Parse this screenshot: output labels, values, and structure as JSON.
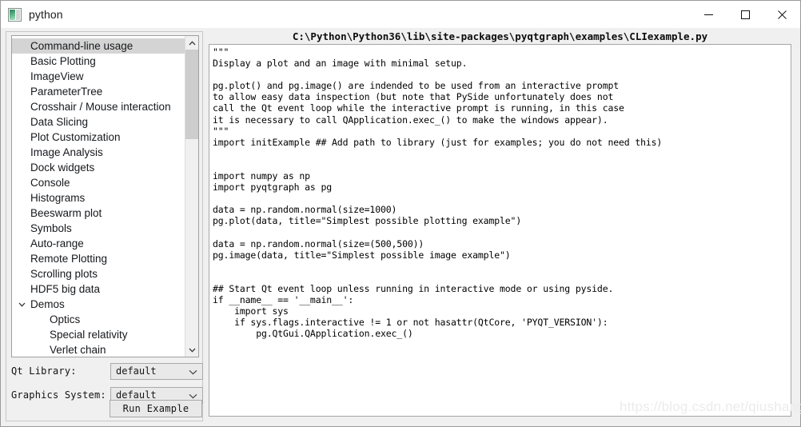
{
  "window": {
    "title": "python",
    "icon": "python-app-icon",
    "buttons": {
      "minimize": "minimize-icon",
      "maximize": "maximize-icon",
      "close": "close-icon"
    }
  },
  "examples_list": {
    "selected": "Command-line usage",
    "items": [
      {
        "label": "Command-line usage",
        "level": 0,
        "selected": true,
        "expandable": false
      },
      {
        "label": "Basic Plotting",
        "level": 0,
        "selected": false,
        "expandable": false
      },
      {
        "label": "ImageView",
        "level": 0,
        "selected": false,
        "expandable": false
      },
      {
        "label": "ParameterTree",
        "level": 0,
        "selected": false,
        "expandable": false
      },
      {
        "label": "Crosshair / Mouse interaction",
        "level": 0,
        "selected": false,
        "expandable": false
      },
      {
        "label": "Data Slicing",
        "level": 0,
        "selected": false,
        "expandable": false
      },
      {
        "label": "Plot Customization",
        "level": 0,
        "selected": false,
        "expandable": false
      },
      {
        "label": "Image Analysis",
        "level": 0,
        "selected": false,
        "expandable": false
      },
      {
        "label": "Dock widgets",
        "level": 0,
        "selected": false,
        "expandable": false
      },
      {
        "label": "Console",
        "level": 0,
        "selected": false,
        "expandable": false
      },
      {
        "label": "Histograms",
        "level": 0,
        "selected": false,
        "expandable": false
      },
      {
        "label": "Beeswarm plot",
        "level": 0,
        "selected": false,
        "expandable": false
      },
      {
        "label": "Symbols",
        "level": 0,
        "selected": false,
        "expandable": false
      },
      {
        "label": "Auto-range",
        "level": 0,
        "selected": false,
        "expandable": false
      },
      {
        "label": "Remote Plotting",
        "level": 0,
        "selected": false,
        "expandable": false
      },
      {
        "label": "Scrolling plots",
        "level": 0,
        "selected": false,
        "expandable": false
      },
      {
        "label": "HDF5 big data",
        "level": 0,
        "selected": false,
        "expandable": false
      },
      {
        "label": "Demos",
        "level": 0,
        "selected": false,
        "expandable": true,
        "expanded": true
      },
      {
        "label": "Optics",
        "level": 1,
        "selected": false,
        "expandable": false
      },
      {
        "label": "Special relativity",
        "level": 1,
        "selected": false,
        "expandable": false
      },
      {
        "label": "Verlet chain",
        "level": 1,
        "selected": false,
        "expandable": false
      }
    ],
    "scrollbar": {
      "up_arrow": "chevron-up-icon",
      "down_arrow": "chevron-down-icon"
    }
  },
  "controls": {
    "qt_library": {
      "label": "Qt Library:",
      "value": "default",
      "arrow": "chevron-down-icon"
    },
    "graphics_system": {
      "label": "Graphics System:",
      "value": "default",
      "arrow": "chevron-down-icon"
    },
    "run_button": "Run Example"
  },
  "code_panel": {
    "path": "C:\\Python\\Python36\\lib\\site-packages\\pyqtgraph\\examples\\CLIexample.py",
    "source": "\"\"\"\nDisplay a plot and an image with minimal setup. \n\npg.plot() and pg.image() are indended to be used from an interactive prompt\nto allow easy data inspection (but note that PySide unfortunately does not\ncall the Qt event loop while the interactive prompt is running, in this case\nit is necessary to call QApplication.exec_() to make the windows appear).\n\"\"\"\nimport initExample ## Add path to library (just for examples; you do not need this)\n\n\nimport numpy as np\nimport pyqtgraph as pg\n\ndata = np.random.normal(size=1000)\npg.plot(data, title=\"Simplest possible plotting example\")\n\ndata = np.random.normal(size=(500,500))\npg.image(data, title=\"Simplest possible image example\")\n\n\n## Start Qt event loop unless running in interactive mode or using pyside.\nif __name__ == '__main__':\n    import sys\n    if sys.flags.interactive != 1 or not hasattr(QtCore, 'PYQT_VERSION'):\n        pg.QtGui.QApplication.exec_()"
  },
  "watermark": "https://blog.csdn.net/qiushangz"
}
